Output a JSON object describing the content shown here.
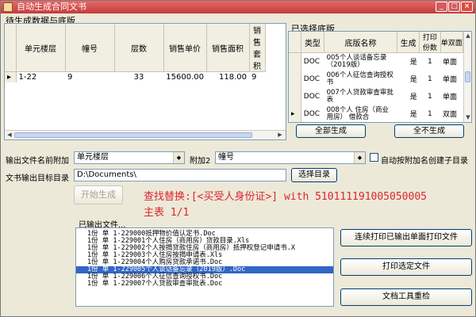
{
  "window": {
    "title": "自动生成合同文书",
    "min": "_",
    "max": "□",
    "close": "×"
  },
  "left_panel": {
    "title": "待生成数据与底版",
    "columns": [
      "单元楼层",
      "幢号",
      "层数",
      "销售单价",
      "销售面积",
      "销售套积"
    ],
    "rows": [
      {
        "unit": "1-22",
        "building": "9",
        "floors": "33",
        "price": "15600.00",
        "area": "118.00",
        "extra": "9"
      }
    ]
  },
  "right_panel": {
    "title": "已选择底版",
    "columns": [
      "类型",
      "底版名称",
      "生成",
      "打印份数",
      "单双面"
    ],
    "rows": [
      {
        "type": "DOC",
        "name": "005个人谈话备忘录（2019版）",
        "gen": "是",
        "copies": "1",
        "side": "单面"
      },
      {
        "type": "DOC",
        "name": "006个人征信查询授权书",
        "gen": "是",
        "copies": "1",
        "side": "单面"
      },
      {
        "type": "DOC",
        "name": "007个人贷款审查审批表",
        "gen": "是",
        "copies": "1",
        "side": "单面"
      },
      {
        "type": "DOC",
        "name": "008个人 住房（商业用房） 借款合",
        "gen": "是",
        "copies": "1",
        "side": "双面"
      }
    ],
    "btn_all_gen": "全部生成",
    "btn_all_nogen": "全不生成"
  },
  "form": {
    "prefix_label": "输出文件名前附加",
    "prefix_value": "单元楼层",
    "prefix2_label": "附加2",
    "prefix2_value": "幢号",
    "auto_subdir_label": "自动按附加名创建子目录",
    "dir_label": "文书输出目标目录",
    "dir_value": "D:\\Documents\\",
    "btn_select_dir": "选择目录"
  },
  "btn_start": "开始生成",
  "status_line1": "查找替换:[<买受人身份证>] with 510111191005050005",
  "status_line2": "主表 1/1",
  "output_label": "已输出文件...",
  "output_files": [
    "1份  单    1-229000抵押物价值认定书.Doc",
    "1份  单    1-229001个人住房（商用房）贷款目录.Xls",
    "1份  单    1-229002个人按揭贷款住房（商用房）抵押权登记申请书.X",
    "1份  单    1-229003个人住房按揭申请表.Xls",
    "1份  单    1-229004个人购房贷款承诺书.Doc",
    "1份  单    1-229005个人谈话备忘录（2019版）.Doc",
    "1份  单    1-229006个人征信查询授权书.Doc",
    "1份  单    1-229007个人贷款审查审批表.Doc"
  ],
  "selected_output_index": 5,
  "btn_print_all": "连续打印已输出单面打印文件",
  "btn_print_selected": "打印选定文件",
  "btn_reset": "文档工具重检",
  "colors": {
    "title_bar": "#c43a3a",
    "status_text": "#e0242f",
    "selection": "#3166c5"
  }
}
